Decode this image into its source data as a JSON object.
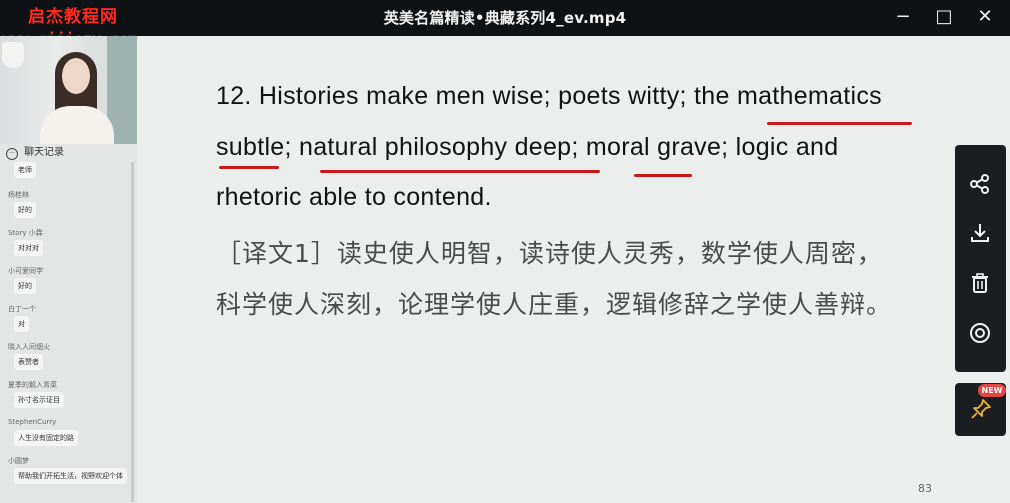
{
  "window": {
    "title": "英美名篇精读•典藏系列4_ev.mp4",
    "minimize_label": "−",
    "maximize_label": "□",
    "close_label": "✕"
  },
  "watermark": {
    "line1": "启杰教程网",
    "line2": "www.qijiezy.com",
    "color": "#ff2a1f"
  },
  "chat": {
    "header": "聊天记录",
    "messages": [
      {
        "user": "",
        "text": "老师"
      },
      {
        "user": "杨桂林",
        "text": "好的"
      },
      {
        "user": "Story 小霖",
        "text": "对对对"
      },
      {
        "user": "小可爱同学",
        "text": "好的"
      },
      {
        "user": "白丁一个",
        "text": "对"
      },
      {
        "user": "晓入人间烟火",
        "text": "表赞者"
      },
      {
        "user": "夏季的鹅入青菜",
        "text": "孙寸名示证目"
      },
      {
        "user": "StephenCurry",
        "text": "人生没有固定的路"
      },
      {
        "user": "小圆梦",
        "text": "帮助我们开拓生活，视野欢迎个体"
      }
    ]
  },
  "slide": {
    "en_line1": "12. Histories make men wise; poets witty; the mathematics",
    "en_line2": "subtle; natural philosophy deep; moral grave; logic and",
    "en_line3": "rhetoric able to contend.",
    "cn_line1": "［译文1］读史使人明智，读诗使人灵秀，数学使人周密，",
    "cn_line2": "科学使人深刻，论理学使人庄重，逻辑修辞之学使人善辩。",
    "page_number": "83",
    "underline_color": "#c8191b"
  },
  "toolbar": {
    "icons": [
      "share-icon",
      "download-icon",
      "trash-icon",
      "record-icon"
    ],
    "pin_icon": "pin-icon",
    "new_badge": "NEW"
  }
}
